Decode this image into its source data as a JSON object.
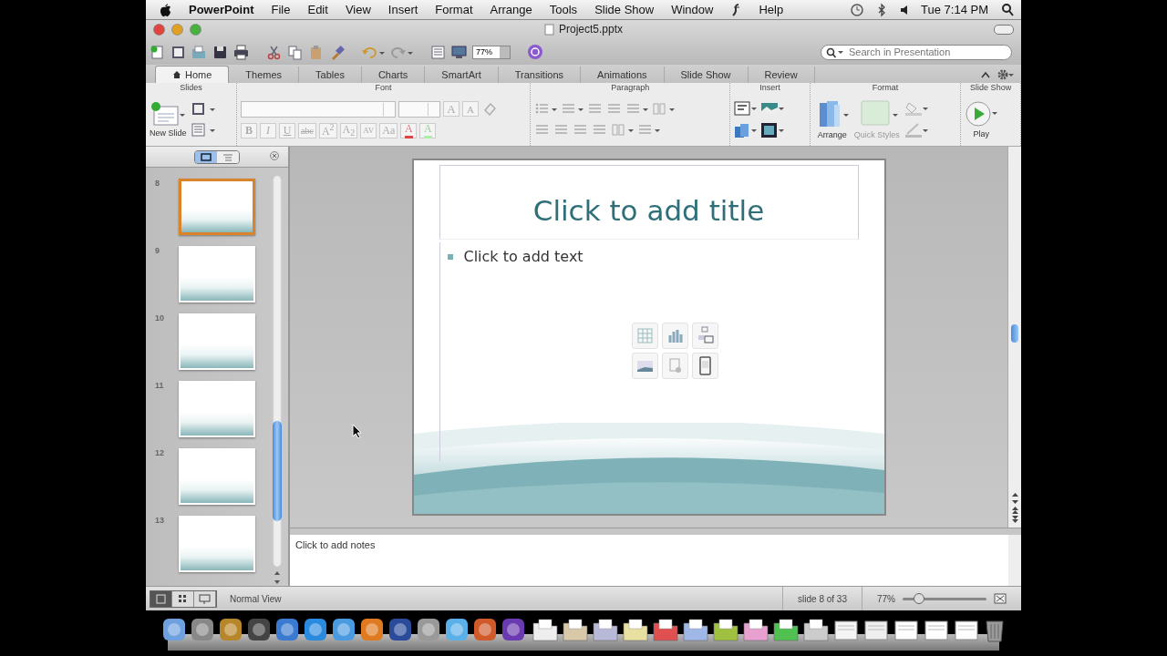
{
  "menubar": {
    "app": "PowerPoint",
    "menus": [
      "File",
      "Edit",
      "View",
      "Insert",
      "Format",
      "Arrange",
      "Tools",
      "Slide Show",
      "Window",
      "Help"
    ],
    "clock": "Tue 7:14 PM"
  },
  "window": {
    "title": "Project5.pptx"
  },
  "toolbar": {
    "zoom": "77%",
    "search": {
      "placeholder": "Search in Presentation"
    }
  },
  "ribbon": {
    "tabs": [
      {
        "label": "Home",
        "selected": true
      },
      {
        "label": "Themes",
        "selected": false
      },
      {
        "label": "Tables",
        "selected": false
      },
      {
        "label": "Charts",
        "selected": false
      },
      {
        "label": "SmartArt",
        "selected": false
      },
      {
        "label": "Transitions",
        "selected": false
      },
      {
        "label": "Animations",
        "selected": false
      },
      {
        "label": "Slide Show",
        "selected": false
      },
      {
        "label": "Review",
        "selected": false
      }
    ],
    "groups": [
      "Slides",
      "Font",
      "Paragraph",
      "Insert",
      "Format",
      "Slide Show"
    ],
    "new_slide": "New Slide",
    "font": {
      "disabled": true,
      "row1": [
        {
          "label": "A",
          "kind": "grow"
        },
        {
          "label": "A",
          "kind": "shrink"
        }
      ],
      "row2": [
        {
          "label": "B",
          "kind": "bold"
        },
        {
          "label": "I",
          "kind": "italic"
        },
        {
          "label": "U",
          "kind": "underline"
        },
        {
          "label": "abc",
          "kind": "strike"
        },
        {
          "label": "A$^{2}$",
          "kind": "plain"
        },
        {
          "label": "A$_{2}$",
          "kind": "plain"
        },
        {
          "label": "AV",
          "kind": "spacing"
        },
        {
          "label": "Aa",
          "kind": "plain"
        },
        {
          "label": "A",
          "kind": "color"
        },
        {
          "label": "A",
          "kind": "highlight"
        }
      ]
    },
    "arrange": "Arrange",
    "quick_styles": "Quick Styles",
    "play": "Play"
  },
  "slides": [
    {
      "number": "8",
      "selected": true
    },
    {
      "number": "9",
      "selected": false
    },
    {
      "number": "10",
      "selected": false
    },
    {
      "number": "11",
      "selected": false
    },
    {
      "number": "12",
      "selected": false
    },
    {
      "number": "13",
      "selected": false
    }
  ],
  "slide": {
    "title": "Click to add title",
    "body": "Click to add text"
  },
  "notes": {
    "prompt": "Click to add notes"
  },
  "status": {
    "view": "Normal View",
    "position": "slide 8 of 33",
    "zoom": "77%",
    "level": 0.2
  }
}
